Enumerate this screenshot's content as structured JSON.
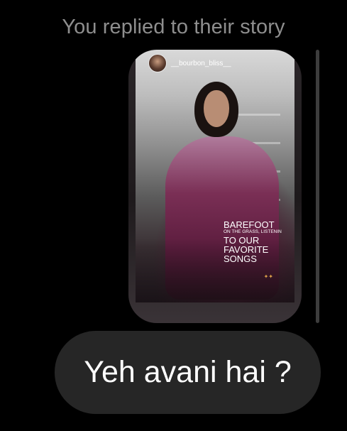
{
  "conversation": {
    "reply_header": "You replied to their story"
  },
  "story": {
    "username": "__bourbon_bliss__",
    "avatar_icon": "profile-avatar",
    "overlay_text": {
      "line1": "BAREFOOT",
      "line2": "ON THE GRASS, LISTENIN",
      "line3": "TO OUR",
      "line4": "FAVORITE",
      "line5": "SONGS"
    },
    "corner_mark_icon": "sparkle-icon"
  },
  "message": {
    "text": "Yeh avani hai ?"
  },
  "colors": {
    "background": "#000000",
    "bubble": "#262626",
    "header_text": "#8e8e8e"
  }
}
